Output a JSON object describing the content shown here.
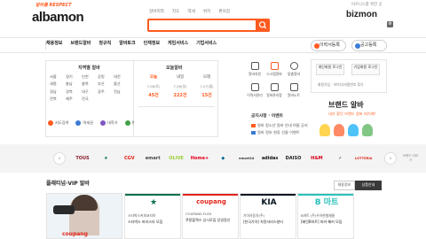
{
  "header": {
    "logo_sub": "알바를 RESPECT",
    "logo": "albamon",
    "top_links": [
      "알바지역",
      "지도",
      "역세",
      "위치",
      "편의점"
    ],
    "search_placeholder": "",
    "bizmon_sub": "비즈니스를 위한 곳",
    "bizmon": "bizmon"
  },
  "nav": {
    "items": [
      "채용정보",
      "브랜드알바",
      "정규직",
      "알바토크",
      "인재정보",
      "게임서비스",
      "기업서비스"
    ],
    "resume_button": "이력서등록",
    "post_button": "공고등록"
  },
  "region": {
    "title": "지역별 알바",
    "items": [
      "서울",
      "경기",
      "인천",
      "강원",
      "대전",
      "세종",
      "충남",
      "충북",
      "부산",
      "울산",
      "경남",
      "경북",
      "대구",
      "광주",
      "전남",
      "전북",
      "제주",
      "전국"
    ],
    "bottom": [
      "지도검색",
      "역세권",
      "대학가",
      "편의점"
    ]
  },
  "today": {
    "title": "오늘알바",
    "days": [
      "오늘",
      "내일",
      "모레"
    ],
    "dates": [
      "7.06(토)",
      "7.06(일)",
      "7.07(월)"
    ],
    "counts": [
      "45건",
      "222건",
      "15건"
    ]
  },
  "quick": {
    "items": [
      "알바지원",
      "스크랩알바",
      "맞춤알바",
      "이력서관리",
      "알바폰지함",
      "알바노트"
    ]
  },
  "notice": {
    "title": "공지사항 · 이벤트",
    "items": [
      "알바 청소년 알바 안내 여름 공지",
      "알바 정보 현장 선물 이벤트"
    ]
  },
  "login": {
    "person": "개인회원 로그인",
    "biz": "기업회원 로그인",
    "links": "회원가입 · 아이디/비밀번호 찾기"
  },
  "brand_banner": {
    "title": "브랜드 알바",
    "sub": "내가 찾던 브랜드 알바 여기에!"
  },
  "brand_strip": {
    "logos": [
      {
        "name": "tous",
        "label": "TOUS",
        "color": "#8b1c2b"
      },
      {
        "name": "starbucks",
        "label": "★",
        "color": "#00704a"
      },
      {
        "name": "cgv",
        "label": "CGV",
        "color": "#e71a0f"
      },
      {
        "name": "emart",
        "label": "emart",
        "color": "#444444"
      },
      {
        "name": "olive",
        "label": "OLIVE",
        "color": "#9acd32"
      },
      {
        "name": "homeplus",
        "label": "Home+",
        "color": "#e2001a"
      },
      {
        "name": "dominos",
        "label": "◆",
        "color": "#006491"
      },
      {
        "name": "emart24",
        "label": "emart24",
        "color": "#333333"
      },
      {
        "name": "adidas",
        "label": "adidas",
        "color": "#111111"
      },
      {
        "name": "daiso",
        "label": "DAISO",
        "color": "#222222"
      },
      {
        "name": "hm",
        "label": "H&M",
        "color": "#d6001c"
      },
      {
        "name": "nike",
        "label": "✓",
        "color": "#222222"
      },
      {
        "name": "lotteria",
        "label": "LOTTERIA",
        "color": "#da291c"
      },
      {
        "name": "mcdonalds",
        "label": "M",
        "color": "#ffc72c"
      },
      {
        "name": "more",
        "label": "브랜드 더보기",
        "color": "#888888"
      }
    ]
  },
  "platinum": {
    "title": "플래티넘·VIP 알바",
    "btn_more": "채용정보",
    "btn_apply": "상품안내",
    "ad_text": "coupang",
    "cards": [
      {
        "logo": "★",
        "logo_color": "#00704a",
        "name": "스타벅스커피코리아",
        "desc": "스타벅스 바리스타 모집",
        "accent": "#00704a"
      },
      {
        "logo": "coupang",
        "logo_color": "#e2231a",
        "name": "COUPANG FLEX",
        "desc": "쿠팡플렉스 상시모집 당일정산",
        "accent": "#e2231a"
      },
      {
        "logo": "KIA",
        "logo_color": "#05141f",
        "name": "기아자동차(주)",
        "desc": "[한국기아] 차량서비스센터",
        "accent": "#05141f"
      },
      {
        "logo": "B 마트",
        "logo_color": "#2ac1bc",
        "name": "B마트 (주)우아한형제들",
        "desc": "[배민B마트] 피커·패커 모집",
        "accent": "#2ac1bc"
      }
    ]
  }
}
